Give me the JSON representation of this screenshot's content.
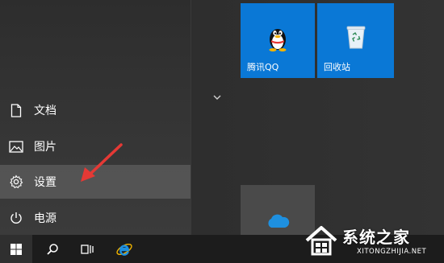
{
  "menu": {
    "items": [
      {
        "label": "文档",
        "icon": "document-icon"
      },
      {
        "label": "图片",
        "icon": "pictures-icon"
      },
      {
        "label": "设置",
        "icon": "gear-icon"
      },
      {
        "label": "电源",
        "icon": "power-icon"
      }
    ],
    "active_item": "设置"
  },
  "tiles": {
    "qq": {
      "label": "腾讯QQ",
      "icon": "qq-penguin-icon"
    },
    "recycle_bin": {
      "label": "回收站",
      "icon": "recycle-bin-icon"
    },
    "onedrive": {
      "icon": "onedrive-cloud-icon"
    }
  },
  "taskbar": {
    "items": [
      {
        "icon": "windows-logo-icon"
      },
      {
        "icon": "search-icon"
      },
      {
        "icon": "task-view-icon"
      },
      {
        "icon": "internet-explorer-icon"
      }
    ]
  },
  "watermark": {
    "title": "系统之家",
    "subtitle": "XITONGZHIJIA.NET"
  },
  "colors": {
    "tile_blue": "#0a78d6",
    "annotation_arrow": "#e53935",
    "taskbar": "#1c1c1c"
  }
}
